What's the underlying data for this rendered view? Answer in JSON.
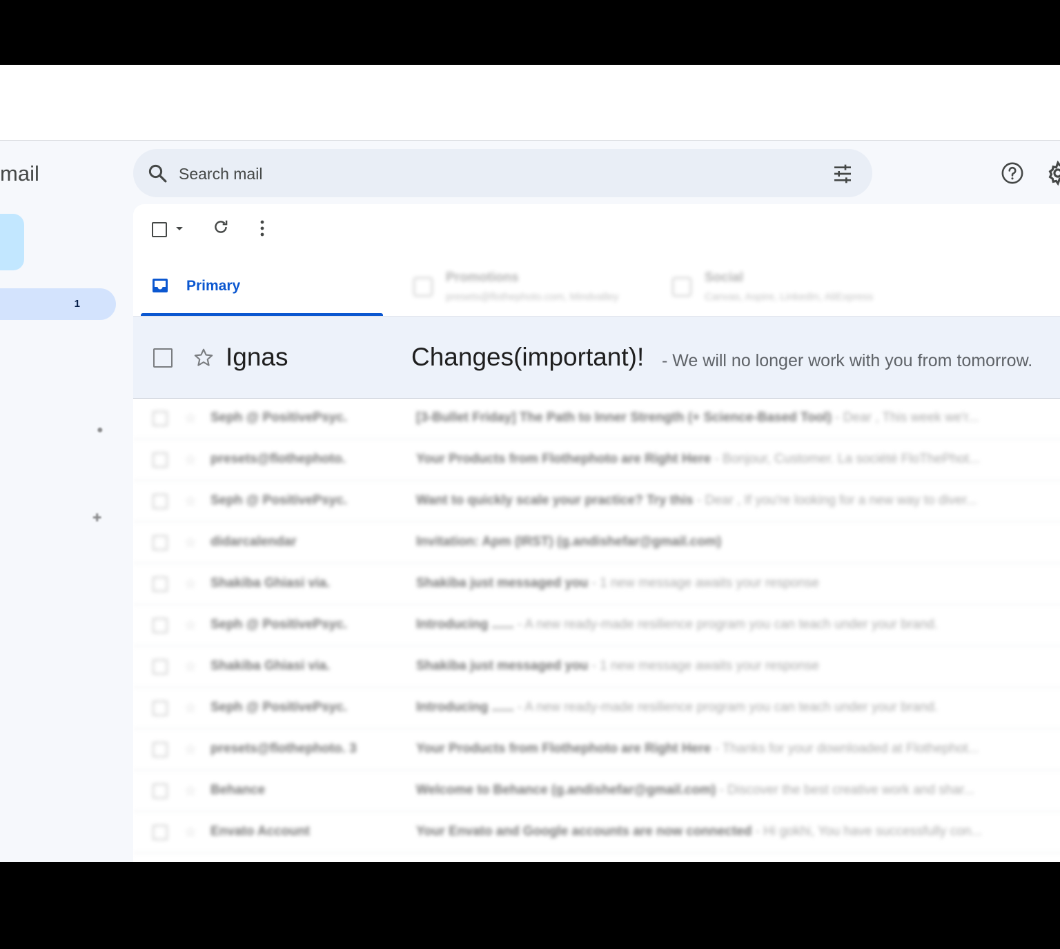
{
  "app": {
    "logo_text": "mail"
  },
  "search": {
    "placeholder": "Search mail"
  },
  "sidebar": {
    "inbox_count": "1"
  },
  "tabs": [
    {
      "label": "Primary"
    },
    {
      "label": "Promotions",
      "sub": "presets@flothephoto.com, Mindvalley"
    },
    {
      "label": "Social",
      "sub": "Canvas, Aspire, LinkedIn, AliExpress"
    }
  ],
  "highlighted_email": {
    "sender": "Ignas",
    "subject": "Changes(important)!",
    "snippet": "- We will no longer work with you from tomorrow."
  },
  "emails": [
    {
      "sender": "Seph @ PositivePsyc.",
      "subject": "[3-Bullet Friday] The Path to Inner Strength (+ Science-Based Tool)",
      "snippet": " - Dear , This week we'r..."
    },
    {
      "sender": "presets@flothephoto.",
      "subject": "Your Products from Flothephoto are Right Here",
      "snippet": " - Bonjour, Customer. La société FloThePhot..."
    },
    {
      "sender": "Seph @ PositivePsyc.",
      "subject": "Want to quickly scale your practice? Try this",
      "snippet": " - Dear , If you're looking for a new way to diver..."
    },
    {
      "sender": "didarcalendar",
      "subject": "Invitation: Apm (IRST) (g.andishefar@gmail.com)",
      "snippet": ""
    },
    {
      "sender": "Shakiba Ghiasi via.",
      "subject": "Shakiba just messaged you",
      "snippet": " - 1 new message awaits your response"
    },
    {
      "sender": "Seph @ PositivePsyc.",
      "subject": "Introducing ......",
      "snippet": " - A new ready-made resilience program you can teach under your brand."
    },
    {
      "sender": "Shakiba Ghiasi via.",
      "subject": "Shakiba just messaged you",
      "snippet": " - 1 new message awaits your response"
    },
    {
      "sender": "Seph @ PositivePsyc.",
      "subject": "Introducing ......",
      "snippet": " - A new ready-made resilience program you can teach under your brand."
    },
    {
      "sender": "presets@flothephoto. 3",
      "subject": "Your Products from Flothephoto are Right Here",
      "snippet": " - Thanks for your downloaded at Flothephot..."
    },
    {
      "sender": "Behance",
      "subject": "Welcome to Behance (g.andishefar@gmail.com)",
      "snippet": " - Discover the best creative work and shar..."
    },
    {
      "sender": "Envato Account",
      "subject": "Your Envato and Google accounts are now connected",
      "snippet": " - Hi gokhi, You have successfully con..."
    }
  ],
  "colors": {
    "accent": "#0b57d0",
    "compose": "#c2e7ff",
    "nav_active": "#d3e3fd",
    "app_bg": "#f6f8fc"
  }
}
